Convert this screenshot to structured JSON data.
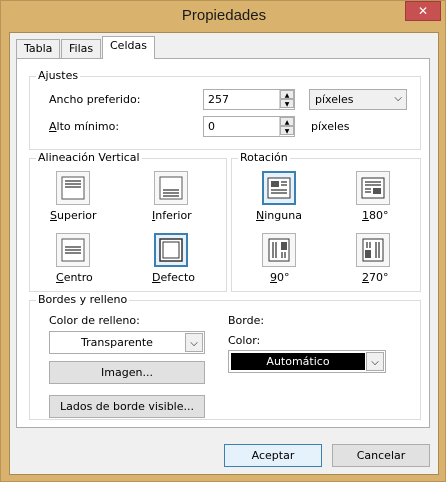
{
  "window": {
    "title": "Propiedades",
    "close_glyph": "✕"
  },
  "tabs": [
    {
      "label": "Tabla"
    },
    {
      "label": "Filas"
    },
    {
      "label": "Celdas"
    }
  ],
  "ajustes": {
    "group_label": "Ajustes",
    "width_label": "Ancho preferido:",
    "width_value": "257",
    "width_unit": "píxeles",
    "height_label_u": "A",
    "height_label_rest": "lto mínimo:",
    "height_value": "0",
    "height_unit": "píxeles"
  },
  "vertical": {
    "group_label": "Alineación Vertical",
    "options": [
      {
        "label_u": "S",
        "label_rest": "uperior"
      },
      {
        "label_u": "I",
        "label_rest": "nferior"
      },
      {
        "label_u": "C",
        "label_rest": "entro"
      },
      {
        "label_u": "D",
        "label_rest": "efecto"
      }
    ],
    "selected": "Defecto"
  },
  "rotation": {
    "group_label": "Rotación",
    "options": [
      {
        "label_u": "N",
        "label_rest": "inguna"
      },
      {
        "label_u": "1",
        "label_rest": "80°"
      },
      {
        "label_u": "9",
        "label_rest": "0°"
      },
      {
        "label_u": "2",
        "label_rest": "70°"
      }
    ],
    "selected": "Ninguna"
  },
  "borders": {
    "group_label": "Bordes y relleno",
    "fill_label": "Color de relleno:",
    "fill_value": "Transparente",
    "image_button": "Imagen...",
    "sides_button": "Lados de borde visible...",
    "border_label": "Borde:",
    "color_label": "Color:",
    "color_value": "Automático"
  },
  "buttons": {
    "ok": "Aceptar",
    "cancel": "Cancelar"
  },
  "colors": {
    "titlebar": "#d9b36e",
    "close": "#c75050",
    "accent": "#3c7fb1"
  }
}
